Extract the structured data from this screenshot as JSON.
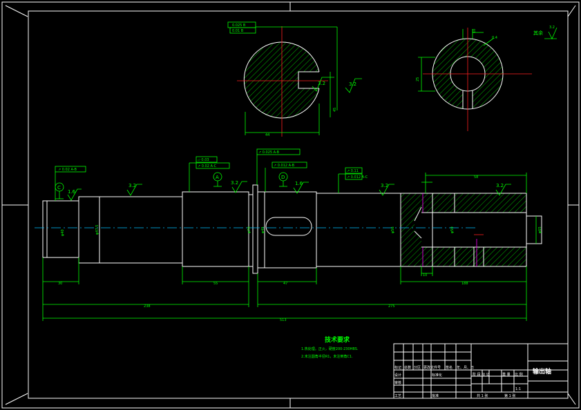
{
  "title_block": {
    "part_name": "输出轴",
    "row1": [
      "标记",
      "处数",
      "分区",
      "更改文件号",
      "签名",
      "年、月、日"
    ],
    "row2": [
      "设计",
      "",
      "",
      "标准化"
    ],
    "row3": [
      "审核"
    ],
    "row4": [
      "工艺",
      "",
      "",
      "批准"
    ],
    "right_head": [
      "阶 段 标 记",
      "重 量",
      "比 例"
    ],
    "scale": "1:1",
    "sheet": [
      "共 1 张",
      "第 1 张"
    ]
  },
  "tech_requirements": {
    "heading": "技术要求",
    "line1": "1.热处理。正火，硬度200-230HBS.",
    "line2": "2.未注圆角半径R1，未注倒角C1."
  },
  "surface_other": "其余",
  "dimensions": {
    "total_length": "513",
    "left_overall": "238",
    "right_overall": "275",
    "left_end": "30",
    "step_55": "55",
    "key_47": "47",
    "bore_depth": "58",
    "right_188": "188",
    "small_10": "10"
  },
  "datums": [
    "A",
    "B",
    "C",
    "D"
  ],
  "roughness": [
    "3.2",
    "1.6",
    "3.2",
    "3.2",
    "1.6",
    "3.2",
    "3.2",
    "3.2"
  ],
  "geo_tol": [
    "0.025 B",
    "0.01 B",
    "0.02 A-B",
    "0.03",
    "0.02 A-C",
    "0.025 A-B",
    "0.012 A-B",
    "0.11",
    "0.012 A-C",
    "0.4"
  ],
  "section_labels": [
    "44",
    "3.2",
    "3.2",
    "3.2",
    "45",
    "0.4",
    "20",
    "10",
    "25"
  ],
  "diameters": [
    "φ40",
    "φ47.5",
    "φ70",
    "φ45",
    "φ56",
    "φ55",
    "φ50",
    "φ16",
    "φ65"
  ]
}
